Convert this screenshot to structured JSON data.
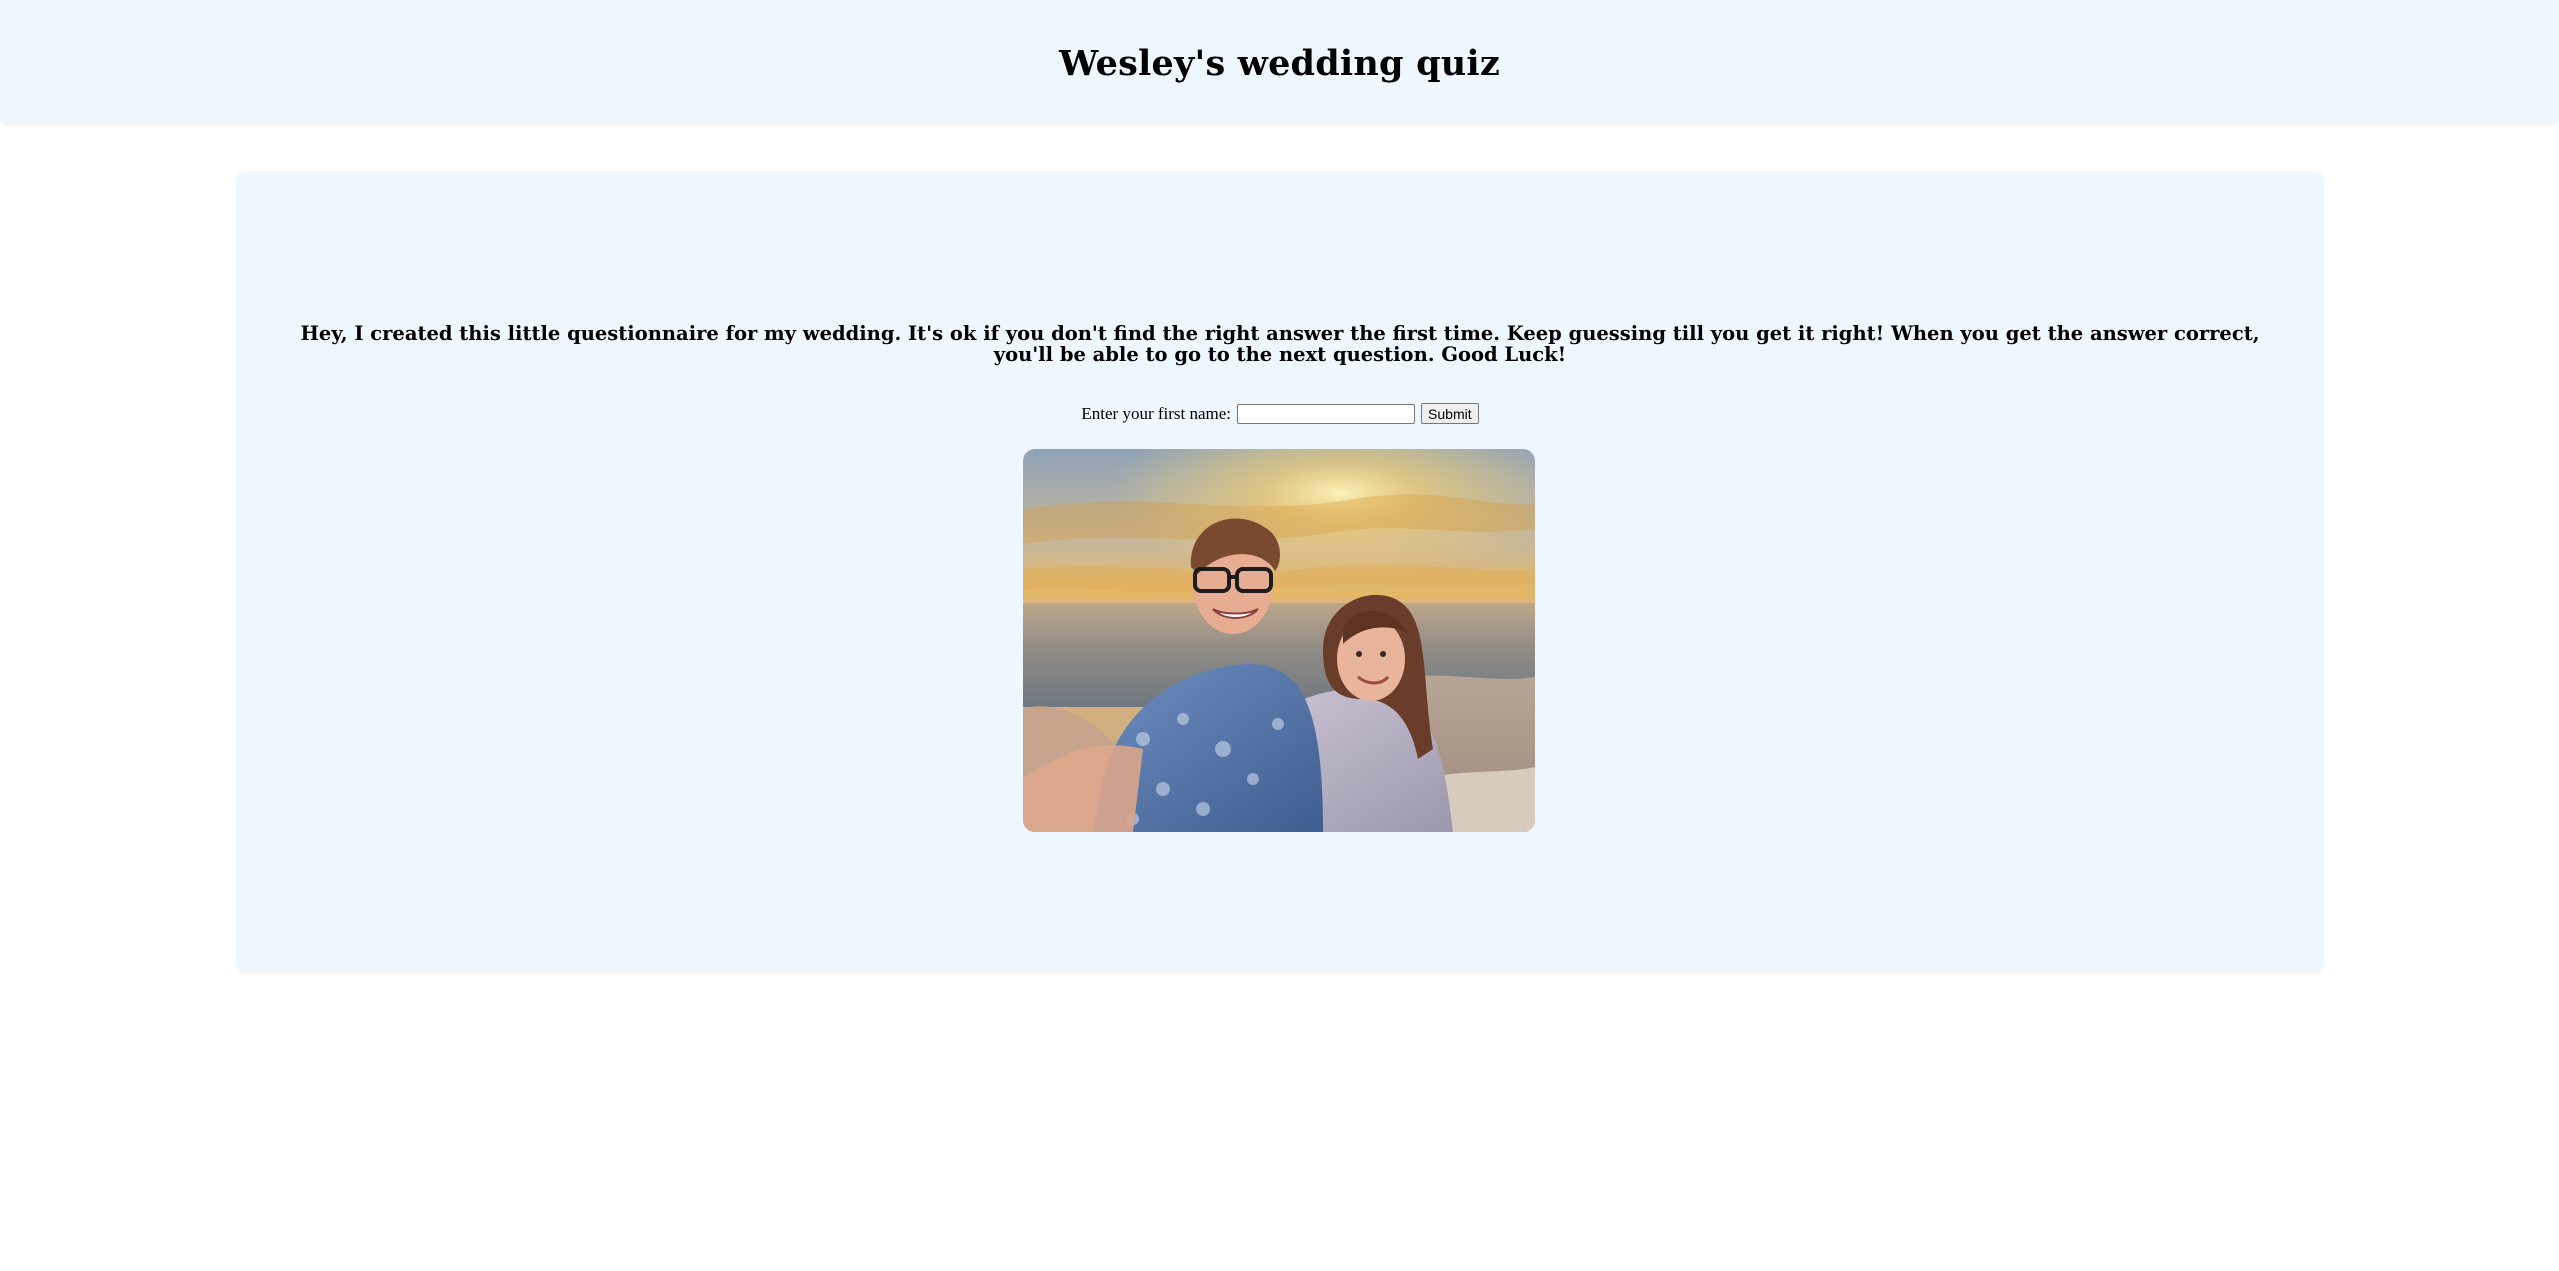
{
  "header": {
    "title": "Wesley's wedding quiz"
  },
  "main": {
    "intro_text": "Hey, I created this little questionnaire for my wedding. It's ok if you don't find the right answer the first time. Keep guessing till you get it right! When you get the answer correct, you'll be able to go to the next question. Good Luck!",
    "form": {
      "name_label": "Enter your first name:",
      "name_value": "",
      "submit_label": "Submit"
    },
    "photo": {
      "icon": "couple-photo"
    }
  },
  "colors": {
    "panel_background": "#eef6fe",
    "page_background": "#ffffff"
  }
}
